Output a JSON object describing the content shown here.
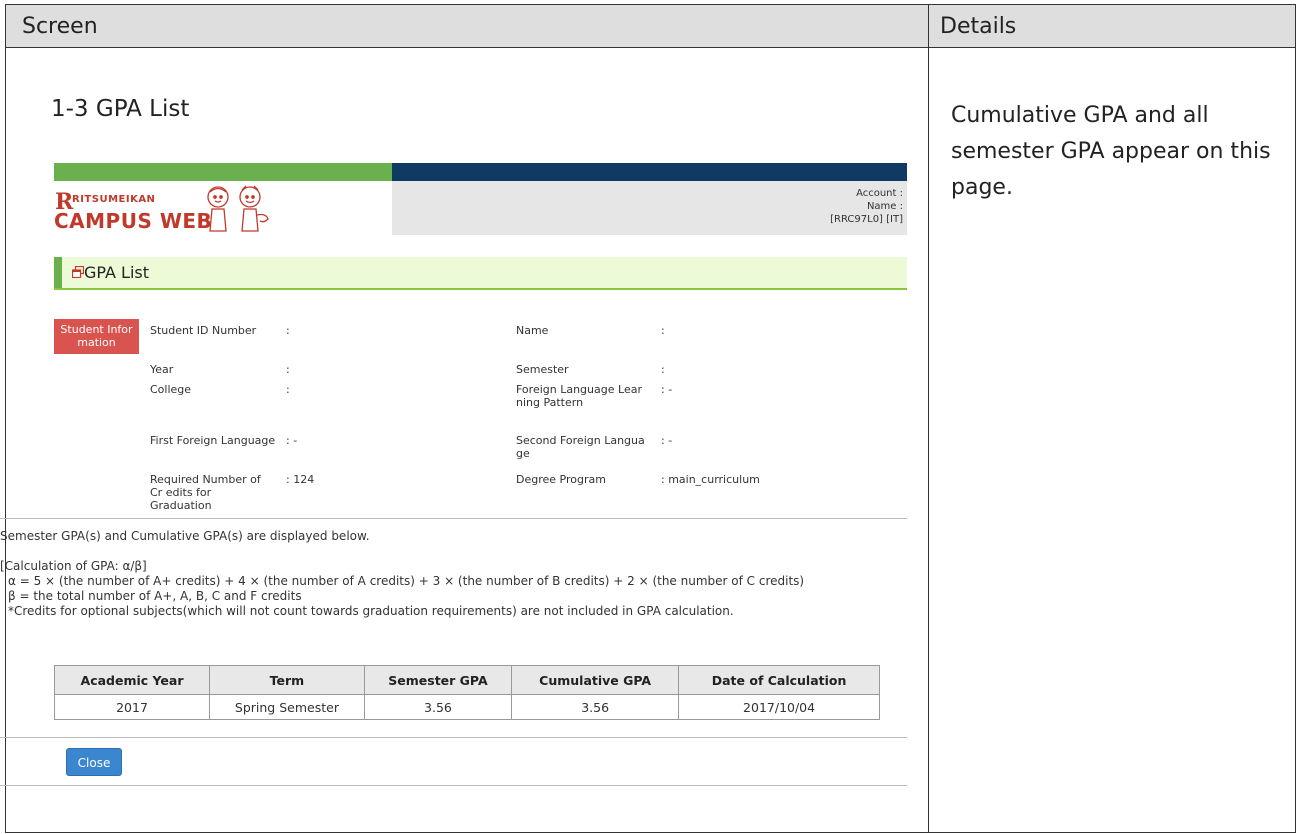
{
  "frame": {
    "screen_header": "Screen",
    "details_header": "Details",
    "section_title": "1-3 GPA List",
    "details_text": "Cumulative GPA and all semester GPA appear on this page."
  },
  "app": {
    "logo": {
      "r": "R",
      "ritsumeikan": "RITSUMEIKAN",
      "campus_web": "CAMPUS WEB"
    },
    "account": {
      "account_label": "Account :",
      "name_label": "Name :",
      "code": "[RRC97L0] [IT]"
    },
    "page_title": "GPA List",
    "student_info_badge": "Student Infor mation",
    "fields": {
      "student_id": {
        "label": "Student ID Number",
        "sep": ":",
        "value": ""
      },
      "name": {
        "label": "Name",
        "sep": ":",
        "value": ""
      },
      "year": {
        "label": "Year",
        "sep": ":",
        "value": ""
      },
      "semester": {
        "label": "Semester",
        "sep": ":",
        "value": ""
      },
      "college": {
        "label": "College",
        "sep": ":",
        "value": ""
      },
      "foreign_lang_pattern": {
        "label": "Foreign Language Lear ning Pattern",
        "sep": ": -"
      },
      "first_foreign": {
        "label": "First Foreign Language",
        "sep": ": -"
      },
      "second_foreign": {
        "label": "Second Foreign Langua ge",
        "sep": ": -"
      },
      "required_credits": {
        "label": "Required Number of Cr edits for Graduation",
        "sep": ": 124"
      },
      "degree_program": {
        "label": "Degree Program",
        "sep": ": main_curriculum"
      }
    },
    "info": {
      "intro": "Semester GPA(s) and Cumulative GPA(s) are displayed below.",
      "calc_title": "[Calculation of GPA: α/β]",
      "alpha": "α = 5 × (the number of A+ credits) + 4 × (the number of A credits) + 3 × (the number of B credits) + 2 × (the number of C credits)",
      "beta": "β = the total number of A+, A, B, C and F credits",
      "note": "*Credits for optional subjects(which will not count towards graduation requirements) are not included in GPA calculation."
    },
    "table": {
      "headers": [
        "Academic Year",
        "Term",
        "Semester GPA",
        "Cumulative GPA",
        "Date of Calculation"
      ],
      "rows": [
        [
          "2017",
          "Spring Semester",
          "3.56",
          "3.56",
          "2017/10/04"
        ]
      ]
    },
    "close_label": "Close"
  }
}
